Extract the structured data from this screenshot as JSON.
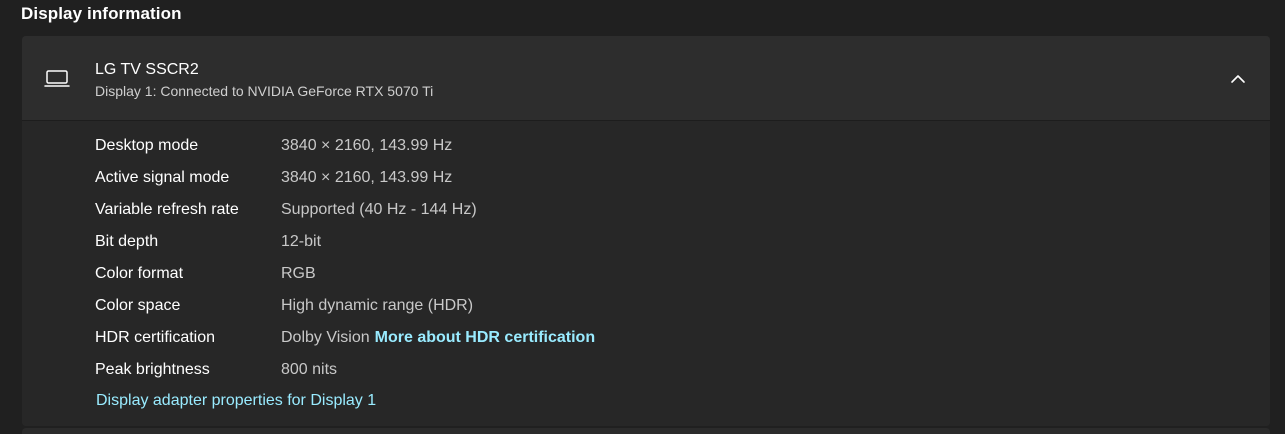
{
  "section": {
    "title": "Display information"
  },
  "display": {
    "name": "LG TV SSCR2",
    "subtitle": "Display 1: Connected to NVIDIA GeForce RTX 5070 Ti",
    "icon": "monitor-icon",
    "expanded_icon": "chevron-up-icon"
  },
  "details": {
    "rows": [
      {
        "label": "Desktop mode",
        "value": "3840 × 2160, 143.99 Hz"
      },
      {
        "label": "Active signal mode",
        "value": "3840 × 2160, 143.99 Hz"
      },
      {
        "label": "Variable refresh rate",
        "value": "Supported (40 Hz - 144 Hz)"
      },
      {
        "label": "Bit depth",
        "value": "12-bit"
      },
      {
        "label": "Color format",
        "value": "RGB"
      },
      {
        "label": "Color space",
        "value": "High dynamic range (HDR)"
      },
      {
        "label": "HDR certification",
        "value": "Dolby Vision",
        "link": "More about HDR certification"
      },
      {
        "label": "Peak brightness",
        "value": "800 nits"
      }
    ],
    "adapter_link": "Display adapter properties for Display 1"
  },
  "colors": {
    "background": "#202020",
    "card": "#2b2b2b",
    "link": "#99ebff"
  }
}
